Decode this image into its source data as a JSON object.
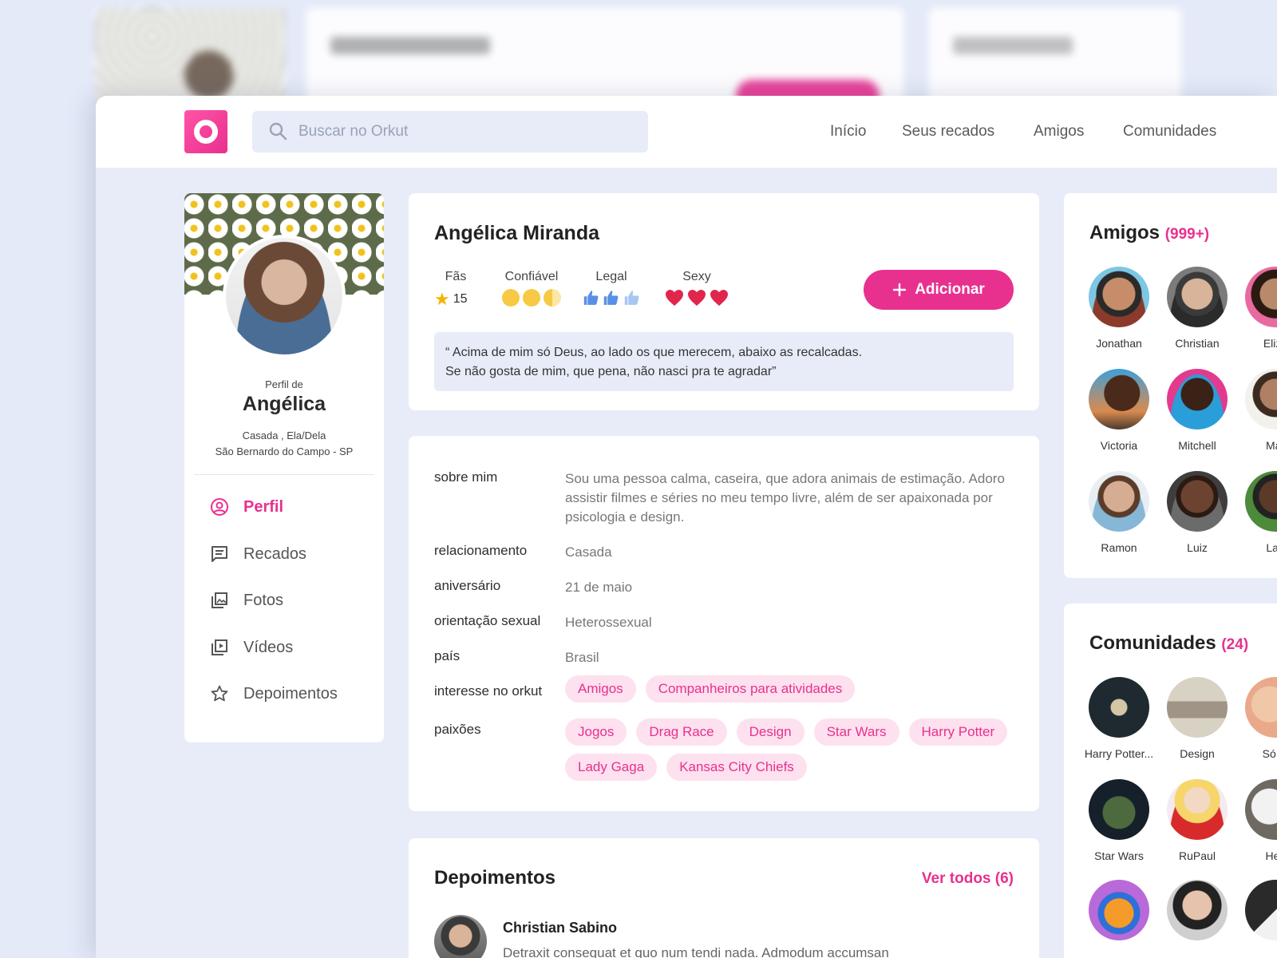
{
  "nav": {
    "search_placeholder": "Buscar no Orkut",
    "links": [
      "Início",
      "Seus recados",
      "Amigos",
      "Comunidades"
    ]
  },
  "profile": {
    "profile_of": "Perfil de",
    "first_name": "Angélica",
    "status": "Casada , Ela/Dela",
    "city": "São Bernardo do Campo - SP",
    "menu": [
      "Perfil",
      "Recados",
      "Fotos",
      "Vídeos",
      "Depoimentos"
    ]
  },
  "header": {
    "full_name": "Angélica Miranda",
    "stats": {
      "fans_label": "Fãs",
      "fans_value": "15",
      "trust_label": "Confiável",
      "cool_label": "Legal",
      "sexy_label": "Sexy"
    },
    "add_button": "Adicionar",
    "quote_line1": "“ Acima de mim só Deus, ao lado os que merecem, abaixo as recalcadas.",
    "quote_line2": "Se não gosta de mim, que pena, não nasci pra te agradar”"
  },
  "info": {
    "about_label": "sobre mim",
    "about_value": "Sou uma pessoa calma, caseira, que adora animais de estimação. Adoro assistir filmes e séries no meu tempo livre, além de ser apaixonada por psicologia e design.",
    "relationship_label": "relacionamento",
    "relationship_value": "Casada",
    "birthday_label": "aniversário",
    "birthday_value": "21 de maio",
    "orientation_label": "orientação sexual",
    "orientation_value": "Heterossexual",
    "country_label": "país",
    "country_value": "Brasil",
    "interest_label": "interesse no orkut",
    "interests": [
      "Amigos",
      "Companheiros para atividades"
    ],
    "passions_label": "paixões",
    "passions": [
      "Jogos",
      "Drag Race",
      "Design",
      "Star Wars",
      "Harry Potter",
      "Lady Gaga",
      "Kansas City Chiefs"
    ]
  },
  "testimonials": {
    "title": "Depoimentos",
    "see_all": "Ver todos (6)",
    "author": "Christian Sabino",
    "text": "Detraxit consequat et quo num tendi nada. Admodum accumsan"
  },
  "friends": {
    "title": "Amigos",
    "count": "(999+)",
    "people": [
      "Jonathan",
      "Christian",
      "Eliza",
      "Victoria",
      "Mitchell",
      "Mar",
      "Ramon",
      "Luiz",
      "Lari"
    ]
  },
  "communities": {
    "title": "Comunidades",
    "count": "(24)",
    "items": [
      "Harry Potter...",
      "Design",
      "Só m",
      "Star Wars",
      "RuPaul",
      "Hec",
      "",
      "",
      ""
    ]
  },
  "colors": {
    "accent": "#e8308f",
    "background": "#e7ecf8",
    "tag_bg": "#fde1ef"
  }
}
